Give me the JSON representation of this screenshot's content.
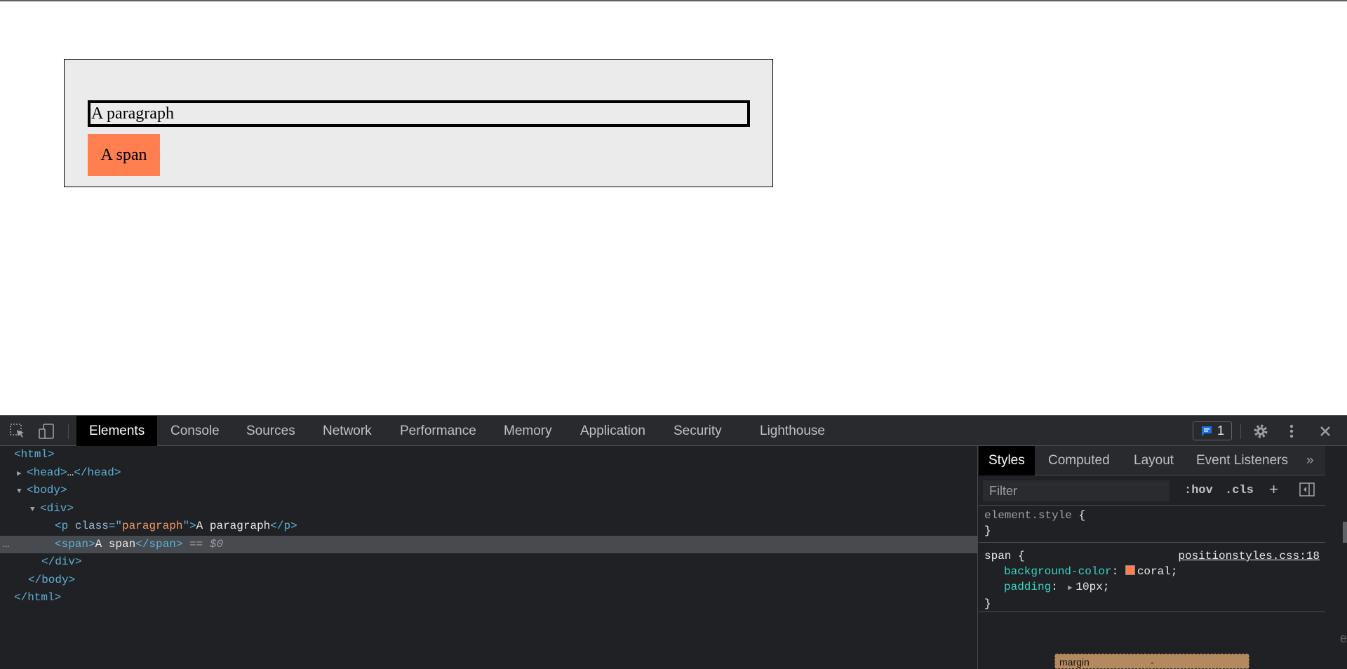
{
  "page": {
    "paragraph_text": "A paragraph",
    "span_text": "A span",
    "span_color": "#ff7f50"
  },
  "devtools": {
    "toolbar": {
      "tabs": [
        "Elements",
        "Console",
        "Sources",
        "Network",
        "Performance",
        "Memory",
        "Application",
        "Security",
        "Lighthouse"
      ],
      "active_tab": "Elements",
      "issues_count": "1"
    },
    "elements": {
      "lines": {
        "l0": {
          "open": "<html>"
        },
        "l1": {
          "tag_open": "<head>",
          "ellipsis": "…",
          "tag_close": "</head>"
        },
        "l2": {
          "tag": "<body>"
        },
        "l3": {
          "tag": "<div>"
        },
        "l4": {
          "tag_open": "<p ",
          "attr_name": "class",
          "eq": "=\"",
          "attr_val": "paragraph",
          "eq_close": "\">",
          "text": "A paragraph",
          "tag_close": "</p>"
        },
        "l5": {
          "tag_open": "<span>",
          "text": "A span",
          "tag_close": "</span>",
          "marker": " == $0",
          "dots": "…"
        },
        "l6": {
          "tag": "</div>"
        },
        "l7": {
          "tag": "</body>"
        },
        "l8": {
          "tag": "</html>"
        }
      }
    },
    "styles": {
      "tabs": [
        "Styles",
        "Computed",
        "Layout",
        "Event Listeners"
      ],
      "more": "»",
      "filter_placeholder": "Filter",
      "hov": ":hov",
      "cls": ".cls",
      "plus": "+",
      "element_style": {
        "selector": "element.style",
        "open": "{",
        "close": "}"
      },
      "span_rule": {
        "selector": "span {",
        "source": "positionstyles.css:18",
        "prop1_name": "background-color",
        "prop1_value": "coral;",
        "prop2_name": "padding",
        "prop2_value": "10px;",
        "close": "}"
      },
      "box_model": {
        "label": "margin",
        "value": "-"
      },
      "edge_letter": "e"
    }
  }
}
